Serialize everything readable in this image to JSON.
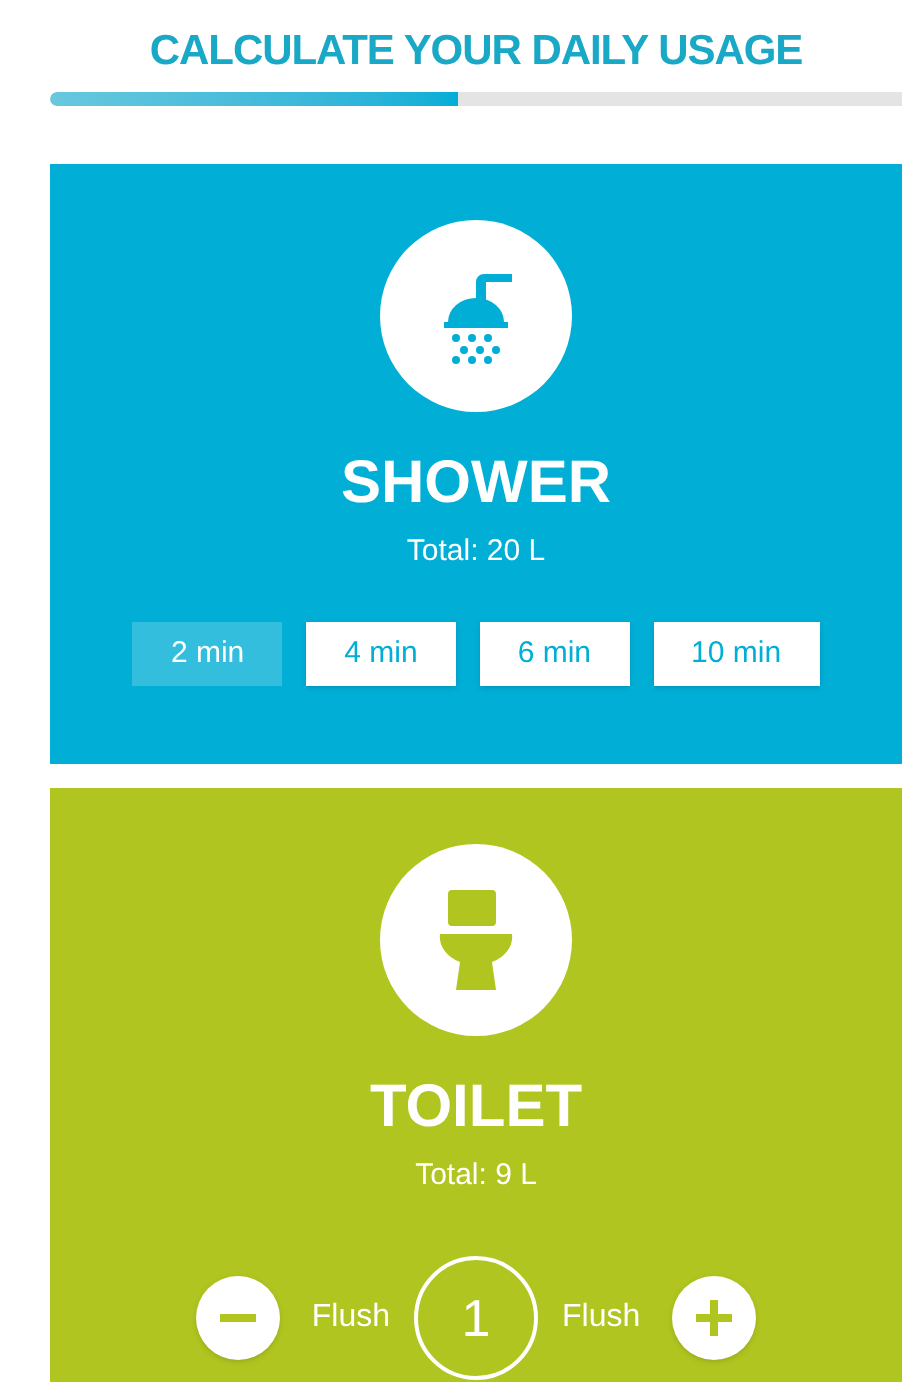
{
  "header": {
    "title": "CALCULATE YOUR DAILY USAGE"
  },
  "progress": {
    "level": 0.48
  },
  "cards": [
    {
      "kind": "options",
      "title": "SHOWER",
      "total": "Total: 20 L",
      "color": "#00aed6",
      "options": [
        {
          "label": "2 min",
          "selected": true
        },
        {
          "label": "4 min",
          "selected": false
        },
        {
          "label": "6 min",
          "selected": false
        },
        {
          "label": "10 min",
          "selected": false
        }
      ]
    },
    {
      "kind": "counter",
      "title": "TOILET",
      "total": "Total: 9 L",
      "color": "#b1c520",
      "counter": {
        "minus_label": "Flush",
        "value": "1",
        "plus_label": "Flush"
      }
    }
  ]
}
